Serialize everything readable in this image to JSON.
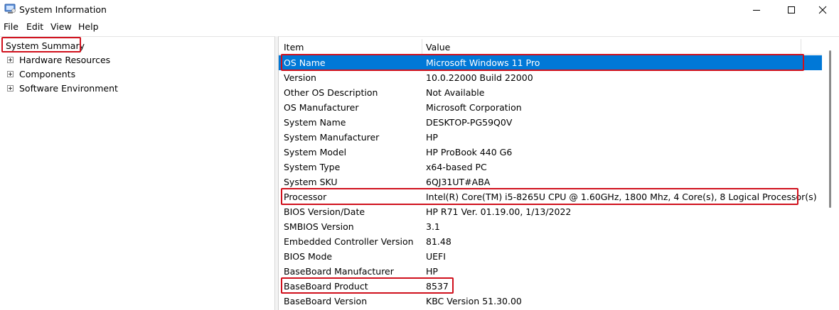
{
  "window": {
    "title": "System Information",
    "icon": "system-information-icon",
    "controls": [
      "minimize-icon",
      "maximize-icon",
      "close-icon"
    ]
  },
  "menu": [
    "File",
    "Edit",
    "View",
    "Help"
  ],
  "tree": {
    "root": "System Summary",
    "children": [
      "Hardware Resources",
      "Components",
      "Software Environment"
    ]
  },
  "table": {
    "columns": [
      "Item",
      "Value"
    ],
    "rows": [
      {
        "item": "OS Name",
        "value": "Microsoft Windows 11 Pro"
      },
      {
        "item": "Version",
        "value": "10.0.22000 Build 22000"
      },
      {
        "item": "Other OS Description",
        "value": "Not Available"
      },
      {
        "item": "OS Manufacturer",
        "value": "Microsoft Corporation"
      },
      {
        "item": "System Name",
        "value": "DESKTOP-PG59Q0V"
      },
      {
        "item": "System Manufacturer",
        "value": "HP"
      },
      {
        "item": "System Model",
        "value": "HP ProBook 440 G6"
      },
      {
        "item": "System Type",
        "value": "x64-based PC"
      },
      {
        "item": "System SKU",
        "value": "6QJ31UT#ABA"
      },
      {
        "item": "Processor",
        "value": "Intel(R) Core(TM) i5-8265U CPU @ 1.60GHz, 1800 Mhz, 4 Core(s), 8 Logical Processor(s)"
      },
      {
        "item": "BIOS Version/Date",
        "value": "HP R71 Ver. 01.19.00, 1/13/2022"
      },
      {
        "item": "SMBIOS Version",
        "value": "3.1"
      },
      {
        "item": "Embedded Controller Version",
        "value": "81.48"
      },
      {
        "item": "BIOS Mode",
        "value": "UEFI"
      },
      {
        "item": "BaseBoard Manufacturer",
        "value": "HP"
      },
      {
        "item": "BaseBoard Product",
        "value": "8537"
      },
      {
        "item": "BaseBoard Version",
        "value": "KBC Version 51.30.00"
      }
    ]
  },
  "selected_row": "OS Name",
  "colors": {
    "selection": "#0078d7",
    "annotation": "#d0101c"
  }
}
